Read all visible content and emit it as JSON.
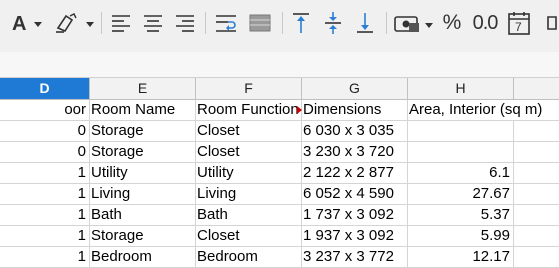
{
  "toolbar": {
    "buttons": [
      {
        "name": "font-color-icon"
      },
      {
        "name": "highlight-color-icon"
      },
      {
        "name": "align-left-icon"
      },
      {
        "name": "align-center-icon"
      },
      {
        "name": "align-right-icon"
      },
      {
        "name": "wrap-text-icon"
      },
      {
        "name": "merge-cells-icon"
      },
      {
        "name": "align-top-icon"
      },
      {
        "name": "align-middle-icon"
      },
      {
        "name": "align-bottom-icon"
      },
      {
        "name": "currency-format-icon"
      },
      {
        "name": "percent-format-icon"
      },
      {
        "name": "decimal-format-icon"
      },
      {
        "name": "date-format-icon"
      }
    ],
    "percent_symbol": "%",
    "decimal_symbol": "0.0",
    "date_day": "7"
  },
  "columns": [
    {
      "letter": "D",
      "selected": true
    },
    {
      "letter": "E",
      "selected": false
    },
    {
      "letter": "F",
      "selected": false
    },
    {
      "letter": "G",
      "selected": false
    },
    {
      "letter": "H",
      "selected": false
    }
  ],
  "header_row": [
    "oor",
    "Room Name",
    "Room Function",
    "Dimensions",
    "Area, Interior (sq m)"
  ],
  "rows": [
    [
      "0",
      "Storage",
      "Closet",
      "6 030 x 3 035",
      ""
    ],
    [
      "0",
      "Storage",
      "Closet",
      "3 230 x 3 720",
      ""
    ],
    [
      "1",
      "Utility",
      "Utility",
      "2 122 x 2 877",
      "6.1"
    ],
    [
      "1",
      "Living",
      "Living",
      "6 052 x 4 590",
      "27.67"
    ],
    [
      "1",
      "Bath",
      "Bath",
      "1 737 x 3 092",
      "5.37"
    ],
    [
      "1",
      "Storage",
      "Closet",
      "1 937 x 3 092",
      "5.99"
    ],
    [
      "1",
      "Bedroom",
      "Bedroom",
      "3 237 x 3 772",
      "12.17"
    ]
  ],
  "colors": {
    "selected_header": "#1f7ad6",
    "toolbar_bg": "#f0f0f0",
    "accent_blue": "#2a7fd4"
  }
}
